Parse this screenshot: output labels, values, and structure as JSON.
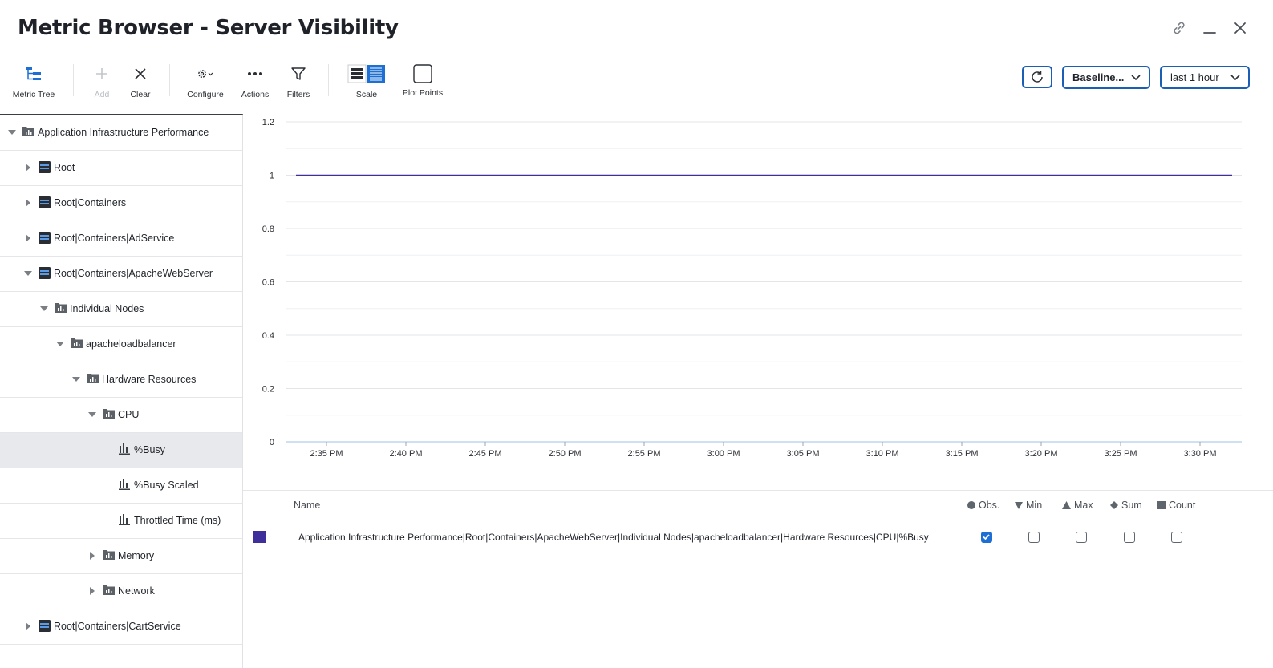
{
  "header": {
    "title": "Metric Browser - Server Visibility"
  },
  "toolbar": {
    "metric_tree": "Metric Tree",
    "add": "Add",
    "clear": "Clear",
    "configure": "Configure",
    "actions": "Actions",
    "filters": "Filters",
    "scale": "Scale",
    "plot_points": "Plot Points",
    "baseline": "Baseline...",
    "time_range": "last 1 hour"
  },
  "colors": {
    "accent": "#1a5fb4",
    "series": "#3f2f9a",
    "checkbox": "#1d6fd3"
  },
  "tree": [
    {
      "label": "Application Infrastructure Performance",
      "level": 0,
      "expanded": true,
      "icon": "folder-chart-icon"
    },
    {
      "label": "Root",
      "level": 1,
      "expanded": false,
      "icon": "server-icon"
    },
    {
      "label": "Root|Containers",
      "level": 1,
      "expanded": false,
      "icon": "server-icon"
    },
    {
      "label": "Root|Containers|AdService",
      "level": 1,
      "expanded": false,
      "icon": "server-icon"
    },
    {
      "label": "Root|Containers|ApacheWebServer",
      "level": 1,
      "expanded": true,
      "icon": "server-icon"
    },
    {
      "label": "Individual Nodes",
      "level": 2,
      "expanded": true,
      "icon": "folder-chart-icon"
    },
    {
      "label": "apacheloadbalancer",
      "level": 3,
      "expanded": true,
      "icon": "folder-chart-icon"
    },
    {
      "label": "Hardware Resources",
      "level": 4,
      "expanded": true,
      "icon": "folder-chart-icon"
    },
    {
      "label": "CPU",
      "level": 5,
      "expanded": true,
      "icon": "folder-chart-icon"
    },
    {
      "label": "%Busy",
      "level": 6,
      "leaf": true,
      "selected": true,
      "icon": "metric-bar-icon"
    },
    {
      "label": "%Busy Scaled",
      "level": 6,
      "leaf": true,
      "icon": "metric-bar-icon"
    },
    {
      "label": "Throttled Time (ms)",
      "level": 6,
      "leaf": true,
      "icon": "metric-bar-icon"
    },
    {
      "label": "Memory",
      "level": 5,
      "expanded": false,
      "icon": "folder-chart-icon"
    },
    {
      "label": "Network",
      "level": 5,
      "expanded": false,
      "icon": "folder-chart-icon"
    },
    {
      "label": "Root|Containers|CartService",
      "level": 1,
      "expanded": false,
      "icon": "server-icon"
    }
  ],
  "chart_data": {
    "type": "line",
    "x": [
      "2:35 PM",
      "2:40 PM",
      "2:45 PM",
      "2:50 PM",
      "2:55 PM",
      "3:00 PM",
      "3:05 PM",
      "3:10 PM",
      "3:15 PM",
      "3:20 PM",
      "3:25 PM",
      "3:30 PM"
    ],
    "y_ticks": [
      "0",
      "0.2",
      "0.4",
      "0.6",
      "0.8",
      "1",
      "1.2"
    ],
    "ylim": [
      0,
      1.2
    ],
    "grid": true,
    "series": [
      {
        "values": [
          1,
          1,
          1,
          1,
          1,
          1,
          1,
          1,
          1,
          1,
          1,
          1
        ],
        "color": "#3f2f9a"
      }
    ]
  },
  "legend": {
    "headers": {
      "name": "Name",
      "obs": "Obs.",
      "min": "Min",
      "max": "Max",
      "sum": "Sum",
      "count": "Count"
    },
    "rows": [
      {
        "name": "Application Infrastructure Performance|Root|Containers|ApacheWebServer|Individual Nodes|apacheloadbalancer|Hardware Resources|CPU|%Busy",
        "obs": true,
        "min": false,
        "max": false,
        "sum": false,
        "count": false
      }
    ]
  }
}
